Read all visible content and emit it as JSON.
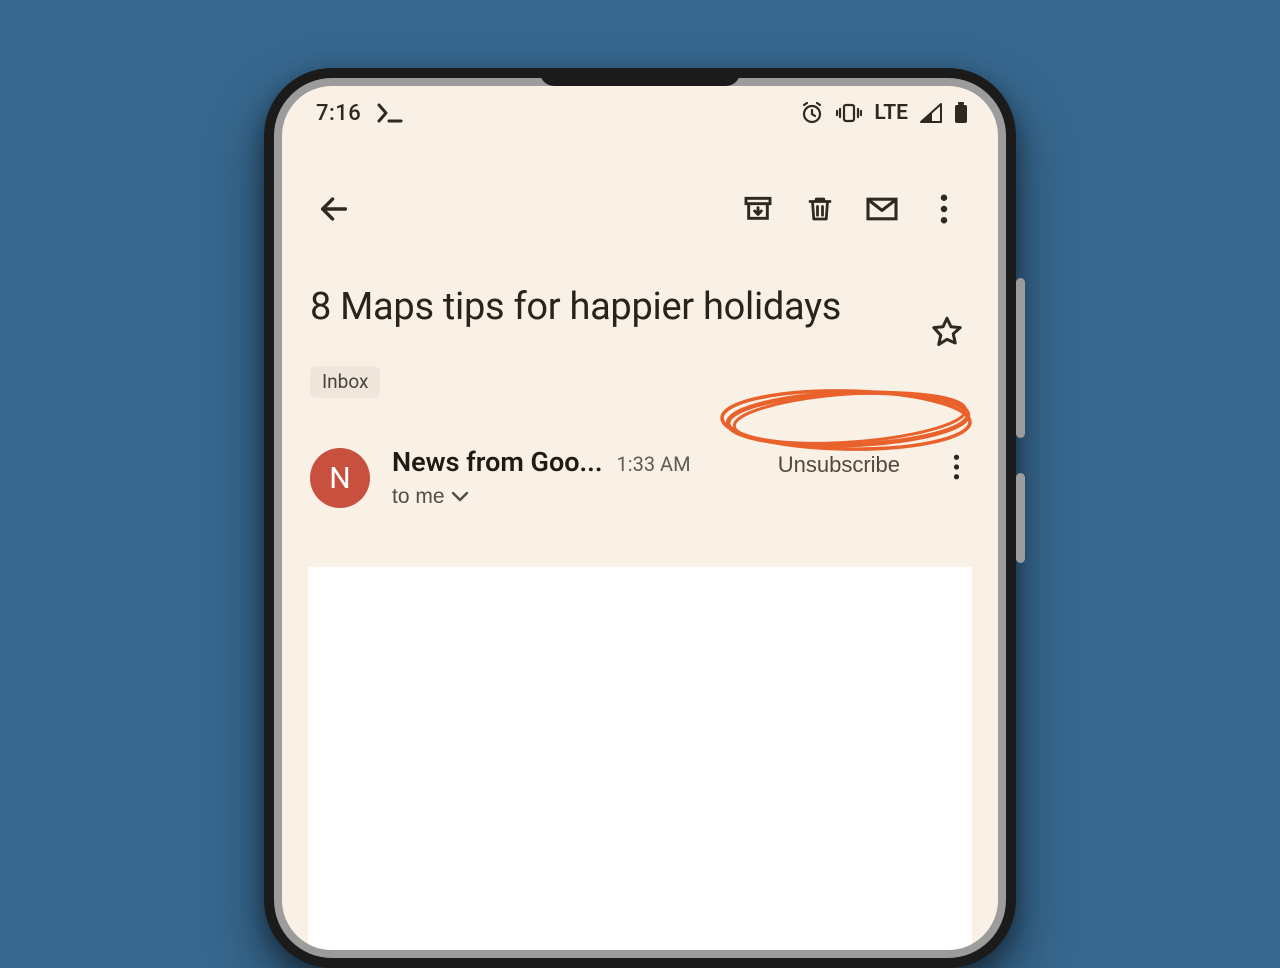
{
  "status": {
    "time": "7:16",
    "network": "LTE"
  },
  "email": {
    "subject": "8 Maps tips for happier holidays",
    "label": "Inbox",
    "sender_initial": "N",
    "sender_name": "News from Goo...",
    "sent_time": "1:33 AM",
    "recipients_summary": "to me",
    "unsubscribe_label": "Unsubscribe"
  },
  "colors": {
    "page_bg": "#37688f",
    "screen_bg": "#faf1e6",
    "avatar": "#c7513e",
    "annotation": "#e9622b"
  }
}
